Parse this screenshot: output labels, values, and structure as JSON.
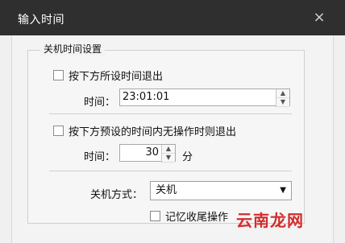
{
  "window": {
    "title": "输入时间",
    "close_glyph": "×"
  },
  "group": {
    "legend": "关机时间设置"
  },
  "option1": {
    "label": "按下方所设时间退出",
    "time_label": "时间：",
    "time_value": "23:01:01"
  },
  "option2": {
    "label": "按下方预设的时间内无操作时则退出",
    "time_label": "时间：",
    "minutes_value": "30",
    "unit": "分"
  },
  "shutdown": {
    "label": "关机方式：",
    "selected": "关机"
  },
  "remember": {
    "label": "记忆收尾操作"
  },
  "watermark": {
    "text": "云南龙网"
  }
}
